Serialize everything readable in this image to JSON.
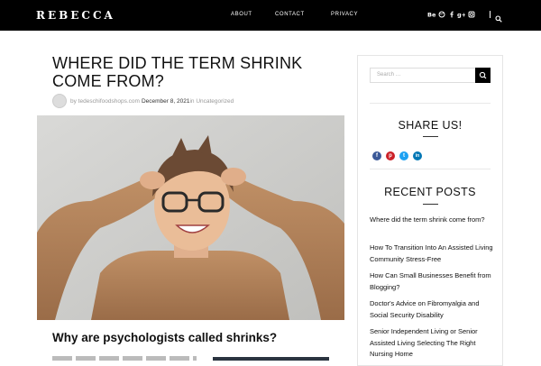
{
  "header": {
    "logo": "REBECCA",
    "nav": [
      {
        "label": "ABOUT"
      },
      {
        "label": "CONTACT"
      },
      {
        "label": "PRIVACY"
      }
    ],
    "social_icons": [
      "behance-icon",
      "dribbble-icon",
      "facebook-icon",
      "google-plus-icon",
      "instagram-icon"
    ]
  },
  "post": {
    "title": "WHERE DID THE TERM SHRINK COME FROM?",
    "author": "by tedeschifoodshops.com",
    "date": "December 8, 2021",
    "category": "in Uncategorized",
    "subheading": "Why are psychologists called shrinks?"
  },
  "sidebar": {
    "search_placeholder": "Search …",
    "share_title": "SHARE US!",
    "share_icons": [
      {
        "name": "facebook",
        "color": "#3b5998",
        "glyph": "f"
      },
      {
        "name": "pinterest",
        "color": "#cb2027",
        "glyph": "p"
      },
      {
        "name": "twitter",
        "color": "#1da1f2",
        "glyph": "t"
      },
      {
        "name": "linkedin",
        "color": "#0077b5",
        "glyph": "in"
      }
    ],
    "recent_title": "RECENT POSTS",
    "recent_posts": [
      "Where did the term shrink come from?",
      "How To Transition Into An Assisted Living Community Stress-Free",
      "How Can Small Businesses Benefit from Blogging?",
      "Doctor's Advice on Fibromyalgia and Social Security Disability",
      "Senior Independent Living or Senior Assisted Living Selecting The Right Nursing Home"
    ]
  }
}
